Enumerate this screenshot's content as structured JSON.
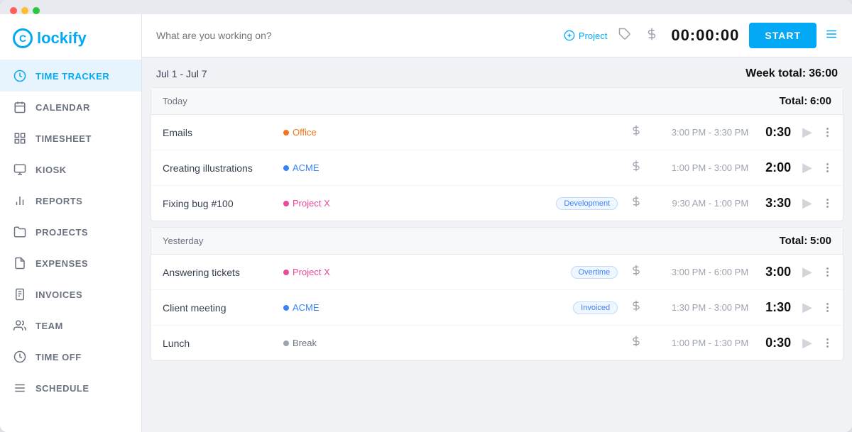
{
  "app": {
    "logo_text": "lockify",
    "window_title": "Clockify"
  },
  "sidebar": {
    "items": [
      {
        "id": "time-tracker",
        "label": "TIME TRACKER",
        "icon": "clock",
        "active": true
      },
      {
        "id": "calendar",
        "label": "CALENDAR",
        "icon": "calendar"
      },
      {
        "id": "timesheet",
        "label": "TIMESHEET",
        "icon": "grid"
      },
      {
        "id": "kiosk",
        "label": "KIOSK",
        "icon": "kiosk"
      },
      {
        "id": "reports",
        "label": "REPORTS",
        "icon": "bar-chart"
      },
      {
        "id": "projects",
        "label": "PROJECTS",
        "icon": "folder"
      },
      {
        "id": "expenses",
        "label": "EXPENSES",
        "icon": "receipt"
      },
      {
        "id": "invoices",
        "label": "INVOICES",
        "icon": "invoice"
      },
      {
        "id": "team",
        "label": "TEAM",
        "icon": "team"
      },
      {
        "id": "time-off",
        "label": "TIME OFF",
        "icon": "time-off"
      },
      {
        "id": "schedule",
        "label": "SCHEDULE",
        "icon": "schedule"
      }
    ]
  },
  "topbar": {
    "input_placeholder": "What are you working on?",
    "add_project_label": "Project",
    "timer": "00:00:00",
    "start_button": "START"
  },
  "week": {
    "range": "Jul 1 - Jul 7",
    "total_label": "Week total:",
    "total_value": "36:00"
  },
  "today": {
    "label": "Today",
    "total_label": "Total:",
    "total_value": "6:00",
    "entries": [
      {
        "name": "Emails",
        "project": "Office",
        "project_color": "orange",
        "tag": "",
        "time_range": "3:00 PM - 3:30 PM",
        "duration": "0:30"
      },
      {
        "name": "Creating illustrations",
        "project": "ACME",
        "project_color": "blue",
        "tag": "",
        "time_range": "1:00 PM - 3:00 PM",
        "duration": "2:00"
      },
      {
        "name": "Fixing bug #100",
        "project": "Project X",
        "project_color": "pink",
        "tag": "Development",
        "tag_class": "tag-development",
        "time_range": "9:30 AM - 1:00 PM",
        "duration": "3:30"
      }
    ]
  },
  "yesterday": {
    "label": "Yesterday",
    "total_label": "Total:",
    "total_value": "5:00",
    "entries": [
      {
        "name": "Answering tickets",
        "project": "Project X",
        "project_color": "pink",
        "tag": "Overtime",
        "tag_class": "tag-overtime",
        "time_range": "3:00 PM - 6:00 PM",
        "duration": "3:00"
      },
      {
        "name": "Client meeting",
        "project": "ACME",
        "project_color": "blue",
        "tag": "Invoiced",
        "tag_class": "tag-invoiced",
        "time_range": "1:30 PM - 3:00 PM",
        "duration": "1:30"
      },
      {
        "name": "Lunch",
        "project": "Break",
        "project_color": "gray",
        "tag": "",
        "time_range": "1:00 PM - 1:30 PM",
        "duration": "0:30"
      }
    ]
  }
}
